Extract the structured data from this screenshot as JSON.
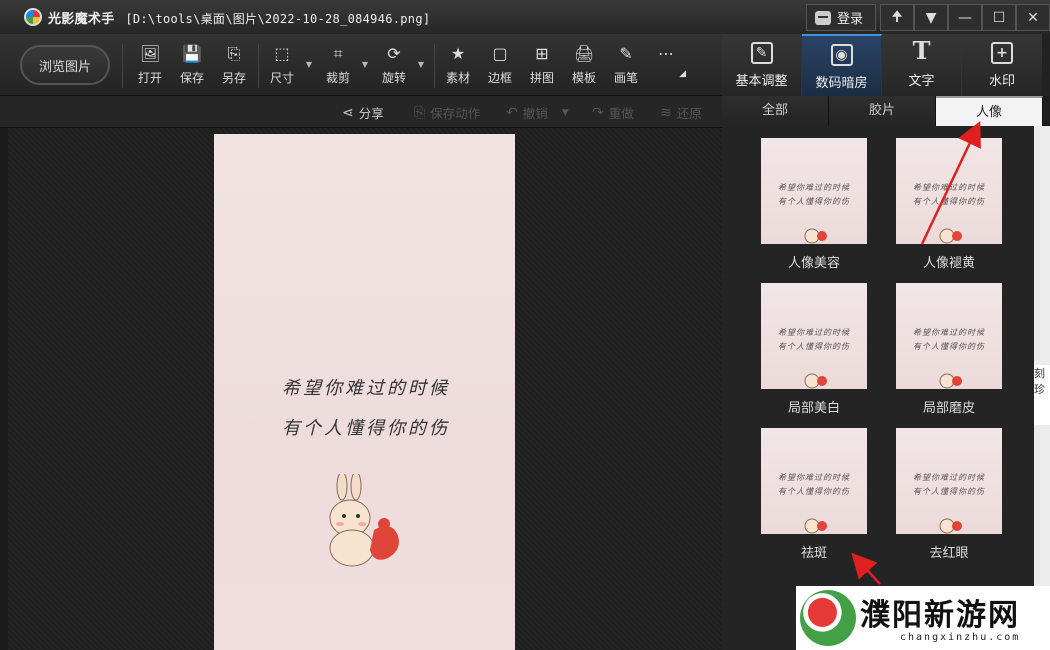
{
  "titlebar": {
    "app_name": "光影魔术手",
    "file_path": "[D:\\tools\\桌面\\图片\\2022-10-28_084946.png]",
    "login": "登录",
    "pin": "🠉",
    "collapse": "▼",
    "min": "—",
    "max": "☐",
    "close": "✕"
  },
  "toolbar": {
    "browse": "浏览图片",
    "tools": [
      {
        "label": "打开",
        "icon": "🖼"
      },
      {
        "label": "保存",
        "icon": "💾"
      },
      {
        "label": "另存",
        "icon": "⎘"
      },
      {
        "label": "尺寸",
        "icon": "⬚"
      },
      {
        "label": "裁剪",
        "icon": "⌗"
      },
      {
        "label": "旋转",
        "icon": "⟳"
      },
      {
        "label": "素材",
        "icon": "★"
      },
      {
        "label": "边框",
        "icon": "▢"
      },
      {
        "label": "拼图",
        "icon": "⊞"
      },
      {
        "label": "模板",
        "icon": "🖨"
      },
      {
        "label": "画笔",
        "icon": "✎"
      },
      {
        "label": "",
        "icon": "⋯"
      }
    ]
  },
  "actions": {
    "share": "分享",
    "save_action": "保存动作",
    "undo": "撤销",
    "redo": "重做",
    "restore": "还原"
  },
  "photo": {
    "line1": "希望你难过的时候",
    "line2": "有个人懂得你的伤"
  },
  "right_panel": {
    "tabs": [
      {
        "label": "基本调整",
        "icon": "✎"
      },
      {
        "label": "数码暗房",
        "icon": "◉"
      },
      {
        "label": "文字",
        "icon": "T"
      },
      {
        "label": "水印",
        "icon": "+"
      }
    ],
    "subtabs": [
      "全部",
      "胶片",
      "人像"
    ],
    "effects": [
      "人像美容",
      "人像褪黄",
      "局部美白",
      "局部磨皮",
      "祛斑",
      "去红眼"
    ]
  },
  "watermark": {
    "text": "濮阳新游网",
    "url": "changxinzhu.com"
  },
  "desktop_edge": "刻\n珍"
}
